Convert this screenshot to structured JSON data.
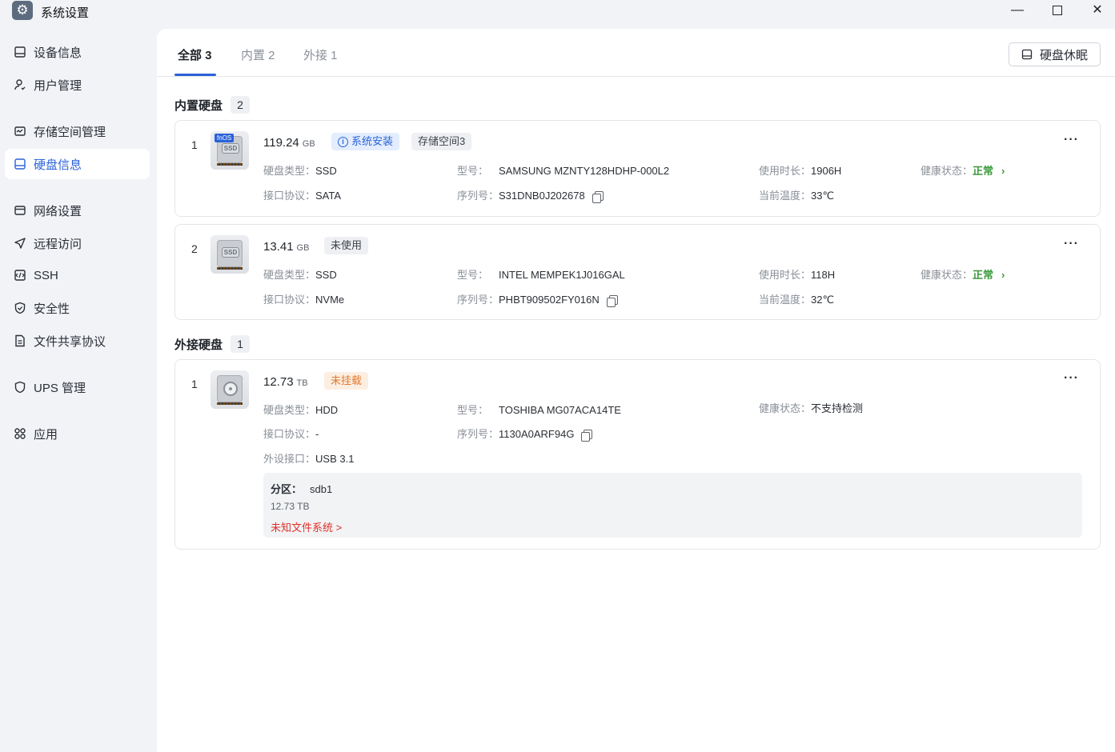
{
  "window": {
    "title": "系统设置",
    "minimize": "—",
    "close": "✕"
  },
  "sidebar": {
    "items": [
      {
        "label": "设备信息",
        "icon": "device-info-icon"
      },
      {
        "label": "用户管理",
        "icon": "user-icon"
      },
      {
        "label": "存储空间管理",
        "icon": "storage-icon"
      },
      {
        "label": "硬盘信息",
        "icon": "disk-icon",
        "active": true
      },
      {
        "label": "网络设置",
        "icon": "network-icon"
      },
      {
        "label": "远程访问",
        "icon": "remote-access-icon"
      },
      {
        "label": "SSH",
        "icon": "ssh-icon"
      },
      {
        "label": "安全性",
        "icon": "shield-icon"
      },
      {
        "label": "文件共享协议",
        "icon": "file-share-icon"
      },
      {
        "label": "UPS 管理",
        "icon": "ups-icon"
      },
      {
        "label": "应用",
        "icon": "apps-icon"
      }
    ]
  },
  "tabs": [
    {
      "label": "全部 3",
      "active": true
    },
    {
      "label": "内置 2"
    },
    {
      "label": "外接 1"
    }
  ],
  "toolbar": {
    "sleep_label": "硬盘休眠"
  },
  "internal": {
    "title": "内置硬盘",
    "count": "2",
    "disks": [
      {
        "index": "1",
        "icon_badge": "fnOS",
        "icon_label": "SSD",
        "size": "119.24",
        "unit": "GB",
        "tags": {
          "system": "系统安装",
          "pool": "存储空间3"
        },
        "type_label": "硬盘类型：",
        "type": "SSD",
        "model_label": "型号：",
        "model": "SAMSUNG MZNTY128HDHP-000L2",
        "hours_label": "使用时长：",
        "hours": "1906H",
        "health_label": "健康状态：",
        "health": "正常",
        "proto_label": "接口协议：",
        "proto": "SATA",
        "serial_label": "序列号：",
        "serial": "S31DNB0J202678",
        "temp_label": "当前温度：",
        "temp": "33℃"
      },
      {
        "index": "2",
        "icon_label": "SSD",
        "size": "13.41",
        "unit": "GB",
        "tags": {
          "status": "未使用"
        },
        "type_label": "硬盘类型：",
        "type": "SSD",
        "model_label": "型号：",
        "model": "INTEL MEMPEK1J016GAL",
        "hours_label": "使用时长：",
        "hours": "118H",
        "health_label": "健康状态：",
        "health": "正常",
        "proto_label": "接口协议：",
        "proto": "NVMe",
        "serial_label": "序列号：",
        "serial": "PHBT909502FY016N",
        "temp_label": "当前温度：",
        "temp": "32℃"
      }
    ]
  },
  "external": {
    "title": "外接硬盘",
    "count": "1",
    "disks": [
      {
        "index": "1",
        "size": "12.73",
        "unit": "TB",
        "tags": {
          "status": "未挂载"
        },
        "type_label": "硬盘类型：",
        "type": "HDD",
        "model_label": "型号：",
        "model": "TOSHIBA MG07ACA14TE",
        "health_label": "健康状态：",
        "health": "不支持检测",
        "proto_label": "接口协议：",
        "proto": "-",
        "serial_label": "序列号：",
        "serial": "1130A0ARF94G",
        "port_label": "外设接口：",
        "port": "USB 3.1",
        "partition": {
          "label": "分区：",
          "name": "sdb1",
          "size": "12.73 TB",
          "fs": "未知文件系统 >"
        }
      }
    ]
  },
  "colors": {
    "accent": "#2a62d9",
    "ok": "#3a9a3a",
    "warn": "#e07a2e",
    "error": "#e0302a"
  }
}
